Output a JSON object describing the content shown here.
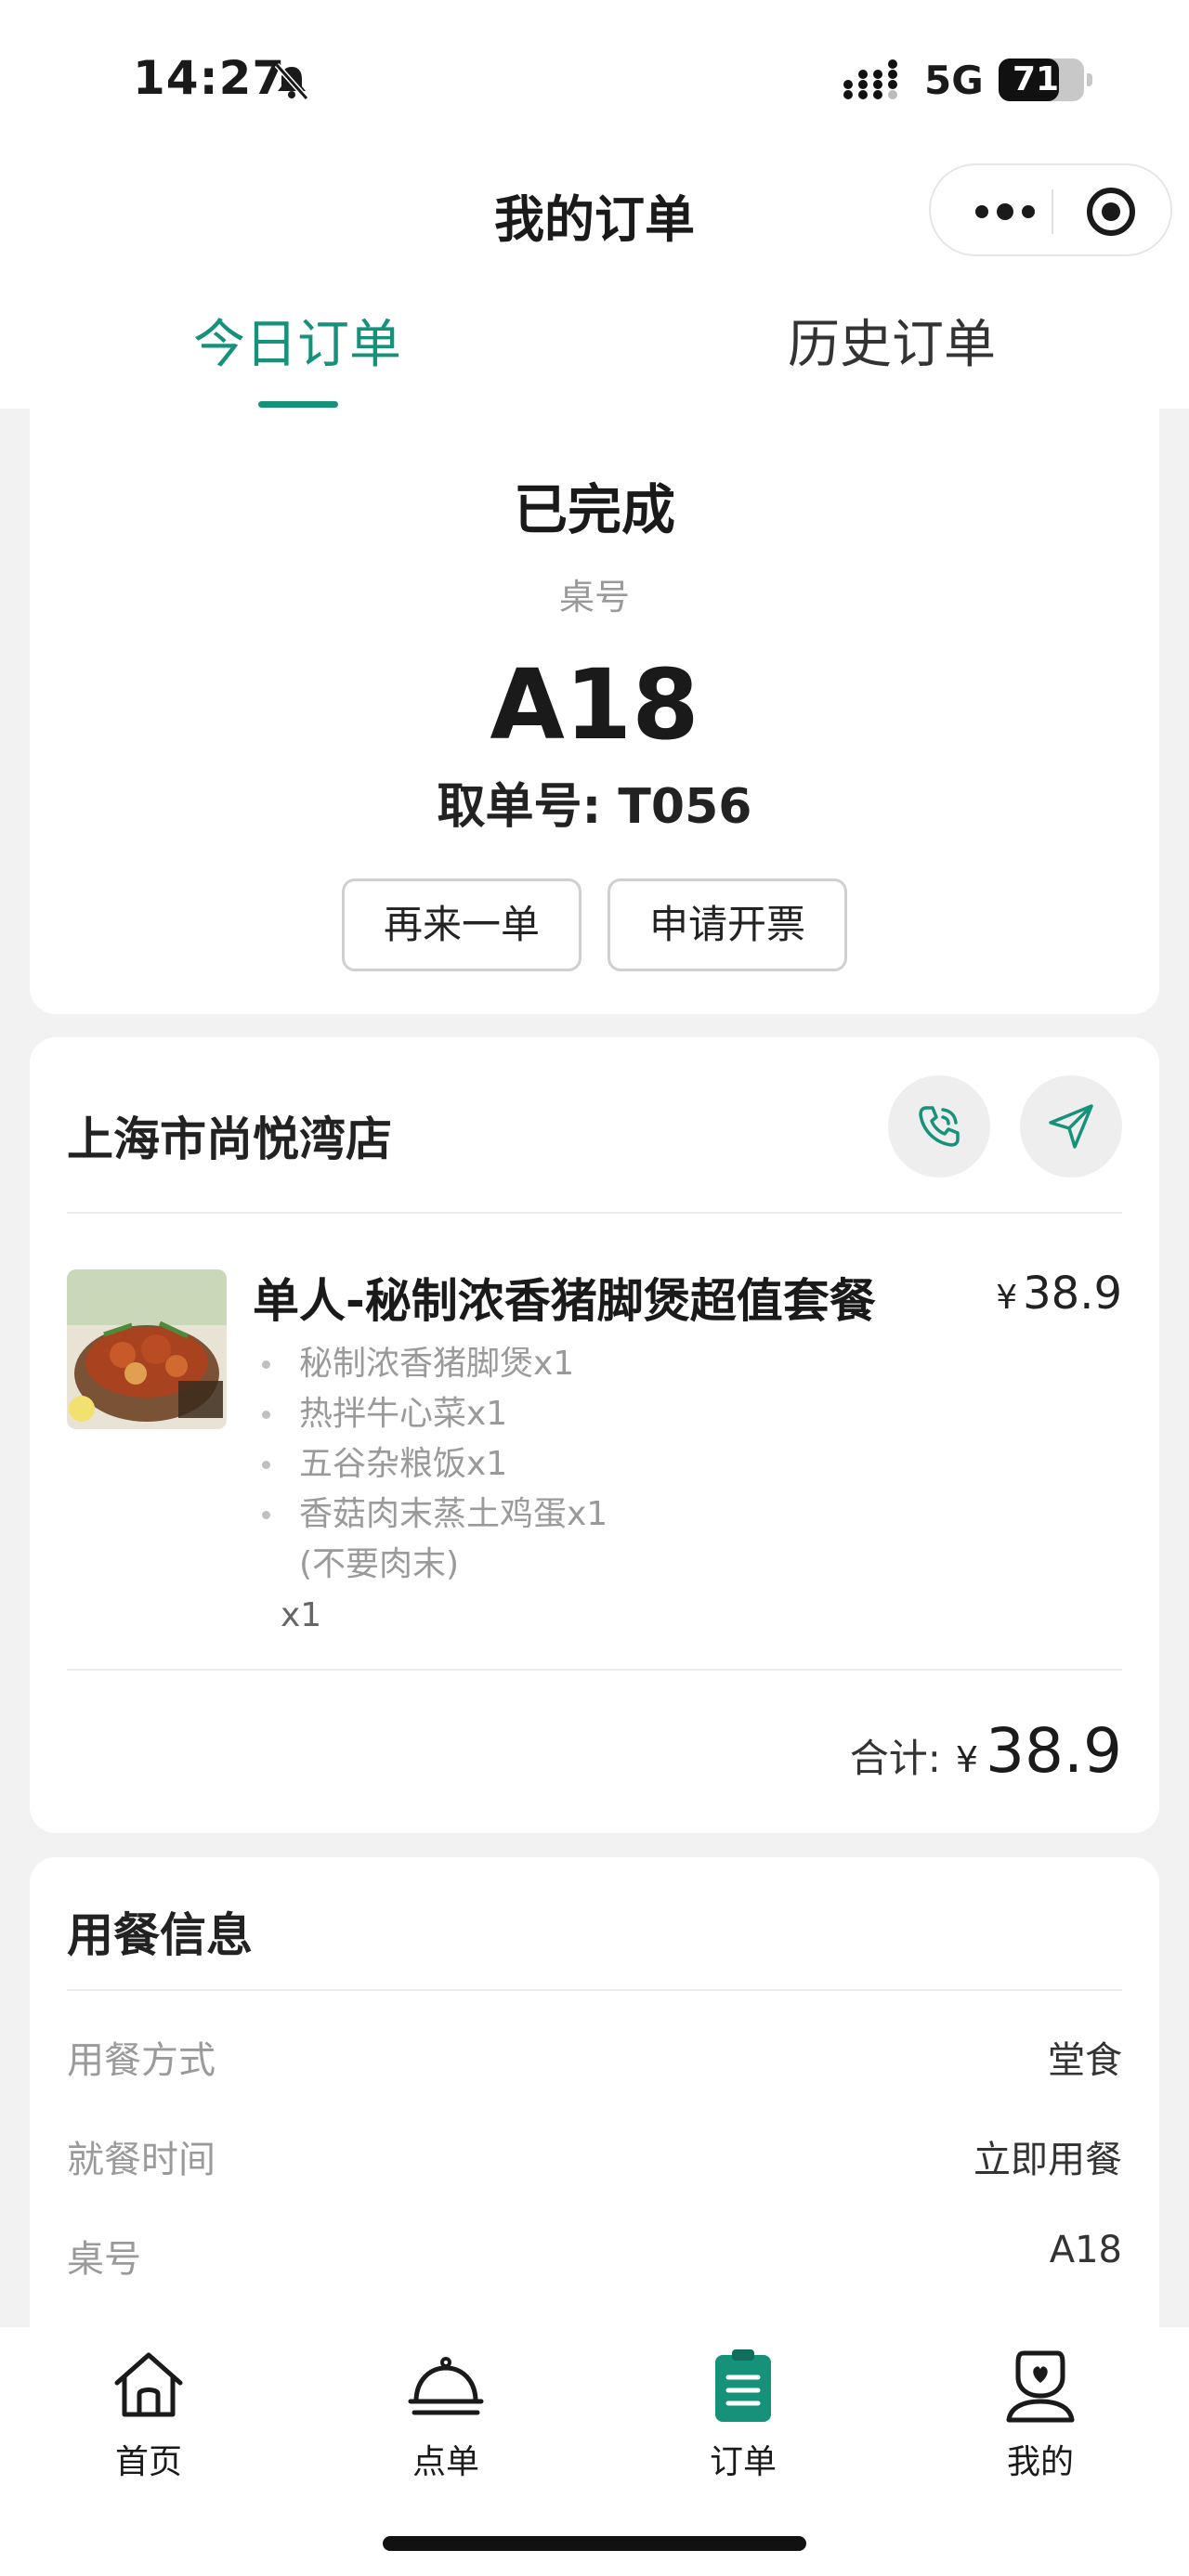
{
  "status_bar": {
    "time": "14:27",
    "network": "5G",
    "battery_level": "71",
    "battery_fraction": 0.71
  },
  "header": {
    "title": "我的订单"
  },
  "tabs": [
    {
      "label": "今日订单",
      "active": true
    },
    {
      "label": "历史订单",
      "active": false
    }
  ],
  "order_status": {
    "status": "已完成",
    "table_label": "桌号",
    "table_number": "A18",
    "pickup_number": "取单号: T056",
    "reorder_label": "再来一单",
    "invoice_label": "申请开票"
  },
  "order": {
    "store_name": "上海市尚悦湾店",
    "item": {
      "name": "单人-秘制浓香猪脚煲超值套餐",
      "currency": "¥",
      "price": "38.9",
      "sub_items": [
        "秘制浓香猪脚煲x1",
        "热拌牛心菜x1",
        "五谷杂粮饭x1",
        "香菇肉末蒸土鸡蛋x1"
      ],
      "sub_note": "(不要肉末)",
      "quantity": "x1"
    },
    "total_label": "合计:",
    "total_currency": "¥",
    "total_amount": "38.9"
  },
  "dining_info": {
    "title": "用餐信息",
    "rows": [
      {
        "key": "用餐方式",
        "value": "堂食"
      },
      {
        "key": "就餐时间",
        "value": "立即用餐"
      },
      {
        "key": "桌号",
        "value": "A18"
      }
    ]
  },
  "tabbar": [
    {
      "label": "首页",
      "icon": "home-icon"
    },
    {
      "label": "点单",
      "icon": "cloche-icon"
    },
    {
      "label": "订单",
      "icon": "clipboard-icon",
      "active": true
    },
    {
      "label": "我的",
      "icon": "profile-icon"
    }
  ],
  "colors": {
    "accent": "#16917a",
    "background": "#f2f2f2",
    "card": "#ffffff"
  }
}
